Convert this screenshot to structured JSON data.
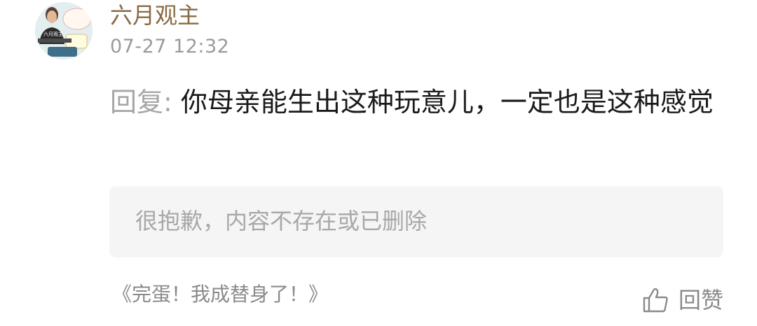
{
  "comment": {
    "avatar_text": "六月观主",
    "username": "六月观主",
    "timestamp": "07-27 12:32",
    "reply_prefix": "回复:",
    "reply_body": " 你母亲能生出这种玩意儿，一定也是这种感觉",
    "quoted_content": "很抱歉，内容不存在或已删除",
    "source_title": "《完蛋！我成替身了！》",
    "like_label": "回赞",
    "icons": {
      "like": "thumbs-up-icon"
    },
    "colors": {
      "username": "#8a6a45",
      "timestamp": "#9a9a9a",
      "reply_prefix": "#a6a6a6",
      "body": "#1a1a1a",
      "quote_bg": "#f5f5f5",
      "muted": "#8a8a8a"
    }
  }
}
